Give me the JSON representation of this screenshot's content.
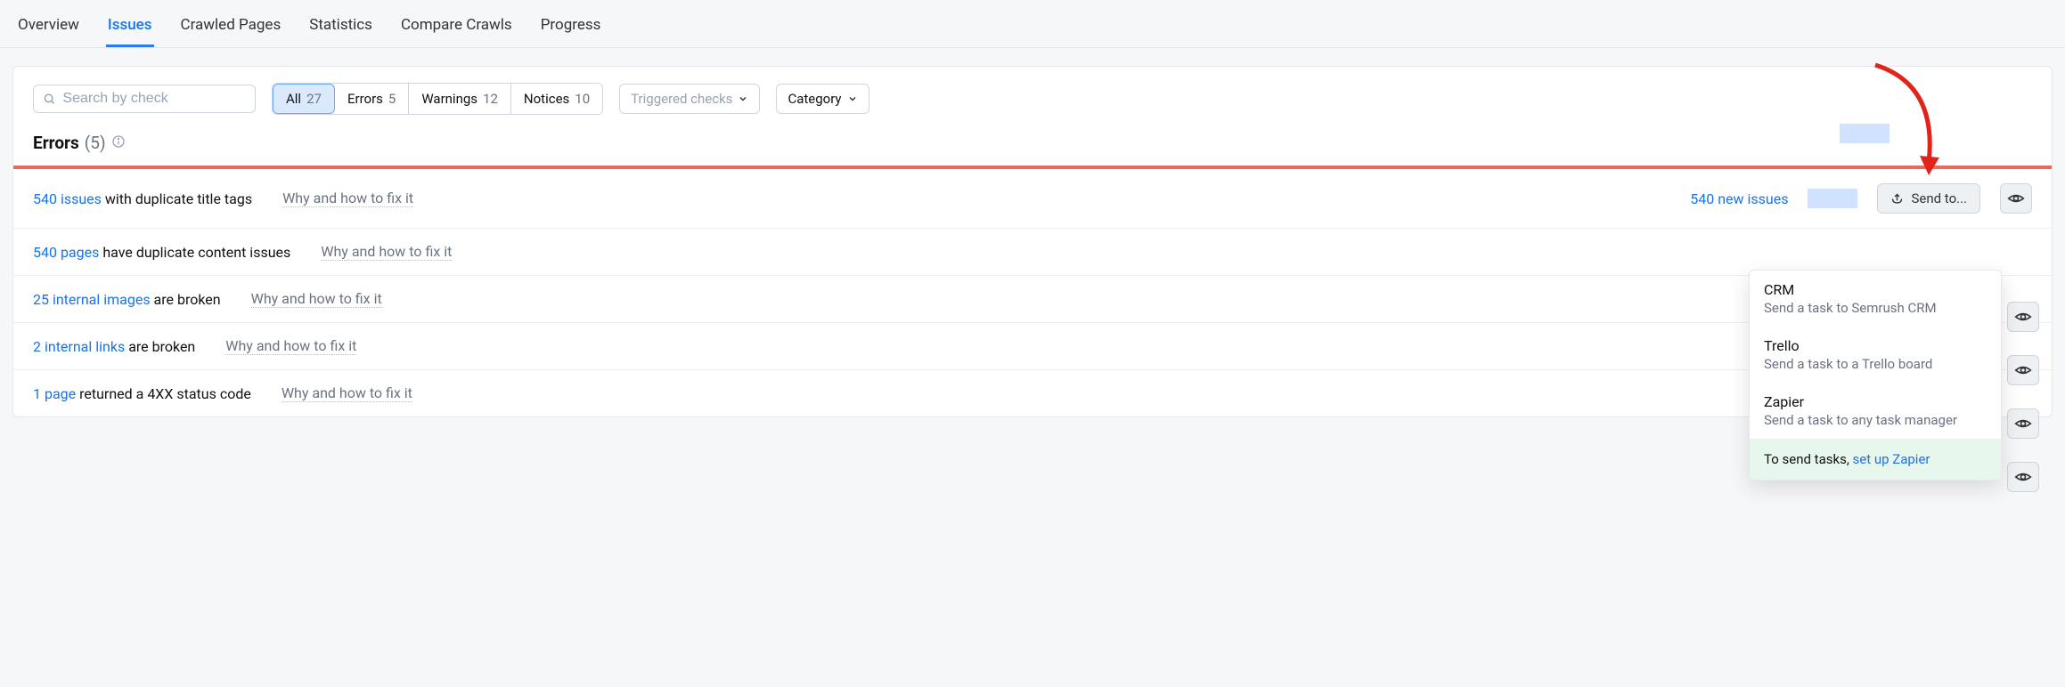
{
  "nav": {
    "tabs": [
      "Overview",
      "Issues",
      "Crawled Pages",
      "Statistics",
      "Compare Crawls",
      "Progress"
    ],
    "active_index": 1
  },
  "toolbar": {
    "search_placeholder": "Search by check",
    "filters": [
      {
        "label": "All",
        "count": 27,
        "active": true
      },
      {
        "label": "Errors",
        "count": 5,
        "active": false
      },
      {
        "label": "Warnings",
        "count": 12,
        "active": false
      },
      {
        "label": "Notices",
        "count": 10,
        "active": false
      }
    ],
    "dropdowns": {
      "triggered": "Triggered checks",
      "category": "Category"
    }
  },
  "section": {
    "title": "Errors",
    "count_display": "(5)"
  },
  "rows": [
    {
      "link_text": "540 issues",
      "label_text": " with duplicate title tags",
      "fix_label": "Why and how to fix it",
      "new_issues": "540 new issues",
      "show_new": true,
      "show_mini_hl": true,
      "show_sendto": true
    },
    {
      "link_text": "540 pages",
      "label_text": " have duplicate content issues",
      "fix_label": "Why and how to fix it",
      "show_new": false
    },
    {
      "link_text": "25 internal images",
      "label_text": " are broken",
      "fix_label": "Why and how to fix it",
      "show_new": false
    },
    {
      "link_text": "2 internal links",
      "label_text": " are broken",
      "fix_label": "Why and how to fix it",
      "show_new": false
    },
    {
      "link_text": "1 page",
      "label_text": " returned a 4XX status code",
      "fix_label": "Why and how to fix it",
      "show_new": false
    }
  ],
  "sendto": {
    "button_label": "Send to...",
    "menu": [
      {
        "title": "CRM",
        "sub": "Send a task to Semrush CRM"
      },
      {
        "title": "Trello",
        "sub": "Send a task to a Trello board"
      },
      {
        "title": "Zapier",
        "sub": "Send a task to any task manager"
      }
    ],
    "footer_prefix": "To send tasks, ",
    "footer_link": "set up Zapier"
  }
}
